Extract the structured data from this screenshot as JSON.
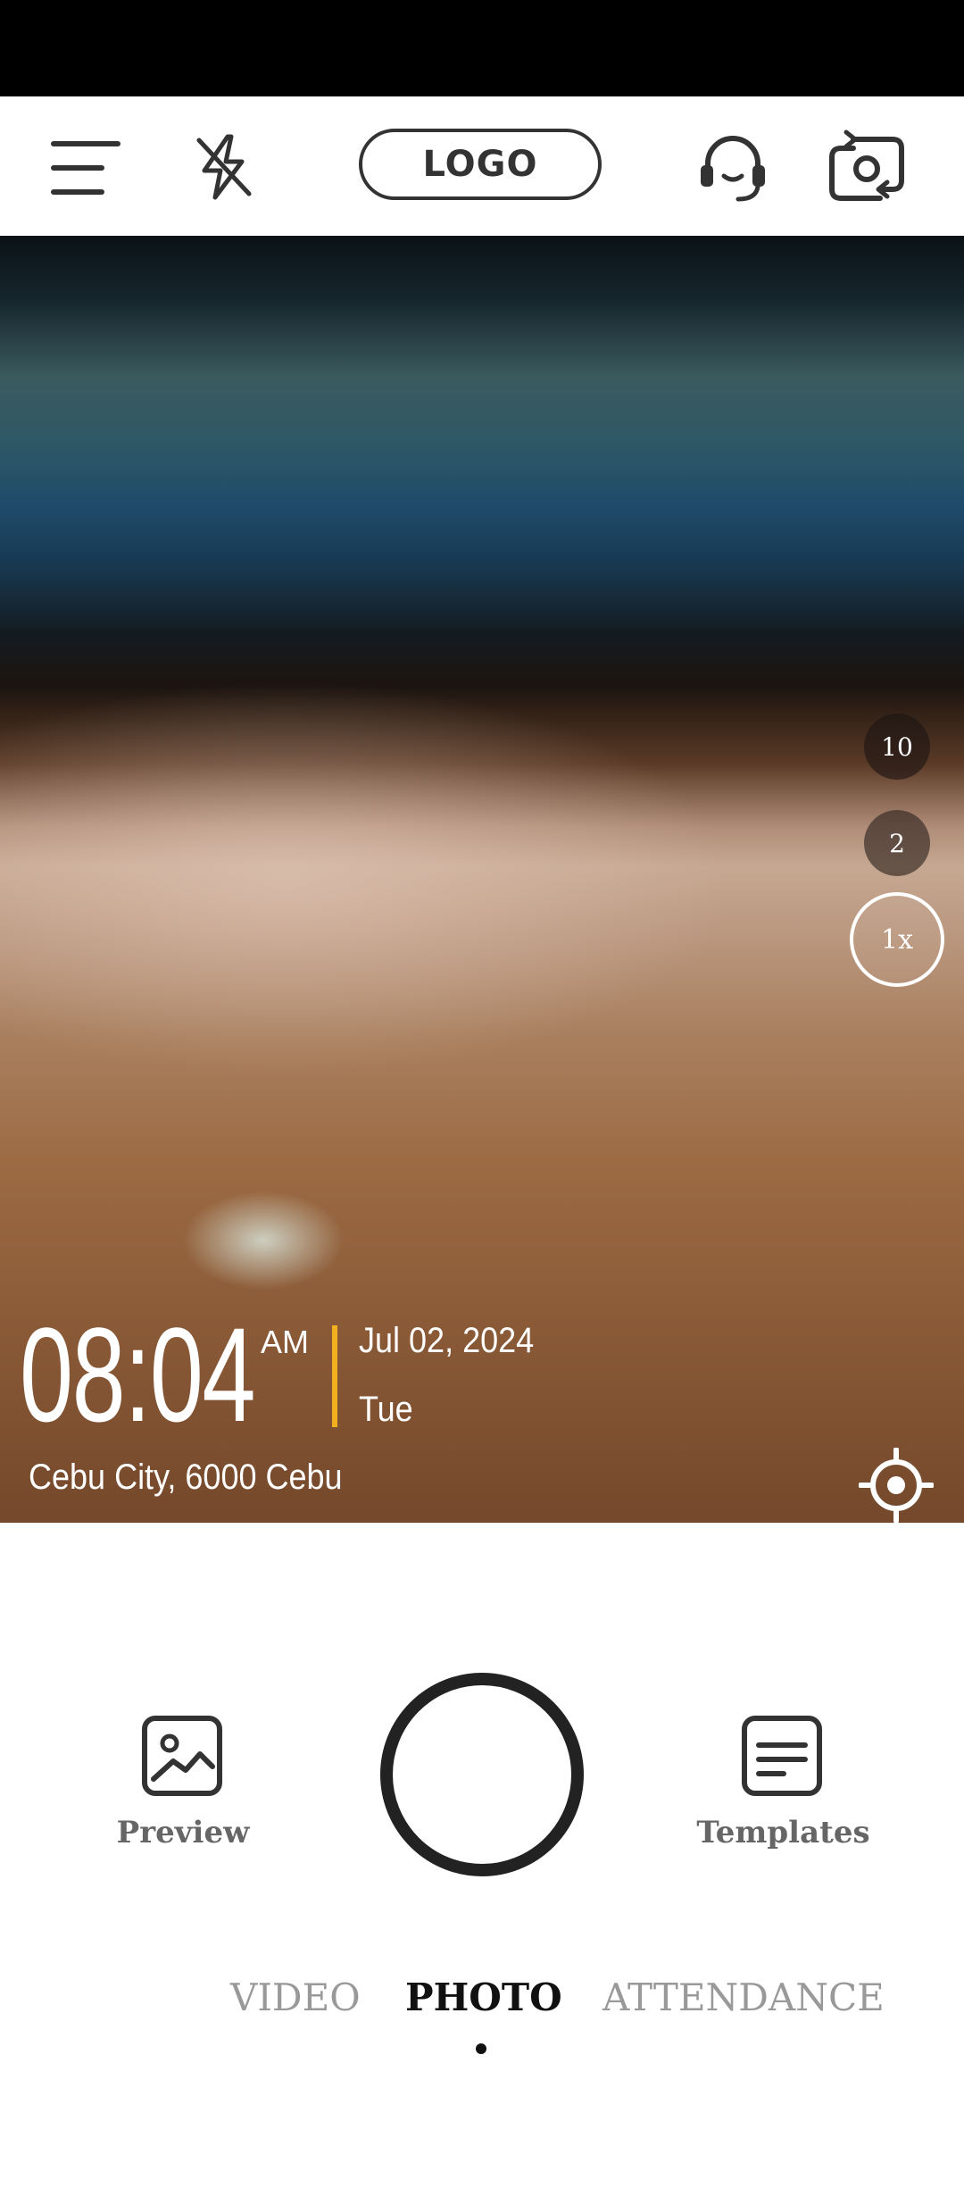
{
  "top_bar": {
    "logo_text": "LOGO",
    "icons": [
      "menu-icon",
      "flash-off-icon",
      "headset-icon",
      "camera-switch-icon"
    ]
  },
  "zoom": {
    "options": [
      "10",
      "2",
      "1x"
    ],
    "selected": "1x"
  },
  "watermark": {
    "time": "08:04",
    "ampm": "AM",
    "date": "Jul 02, 2024",
    "day": "Tue",
    "location": "Cebu City, 6000 Cebu",
    "accent_color": "#f2b01e"
  },
  "bottom": {
    "preview_label": "Preview",
    "templates_label": "Templates"
  },
  "modes": {
    "items": [
      "VIDEO",
      "PHOTO",
      "ATTENDANCE"
    ],
    "selected": "PHOTO"
  }
}
